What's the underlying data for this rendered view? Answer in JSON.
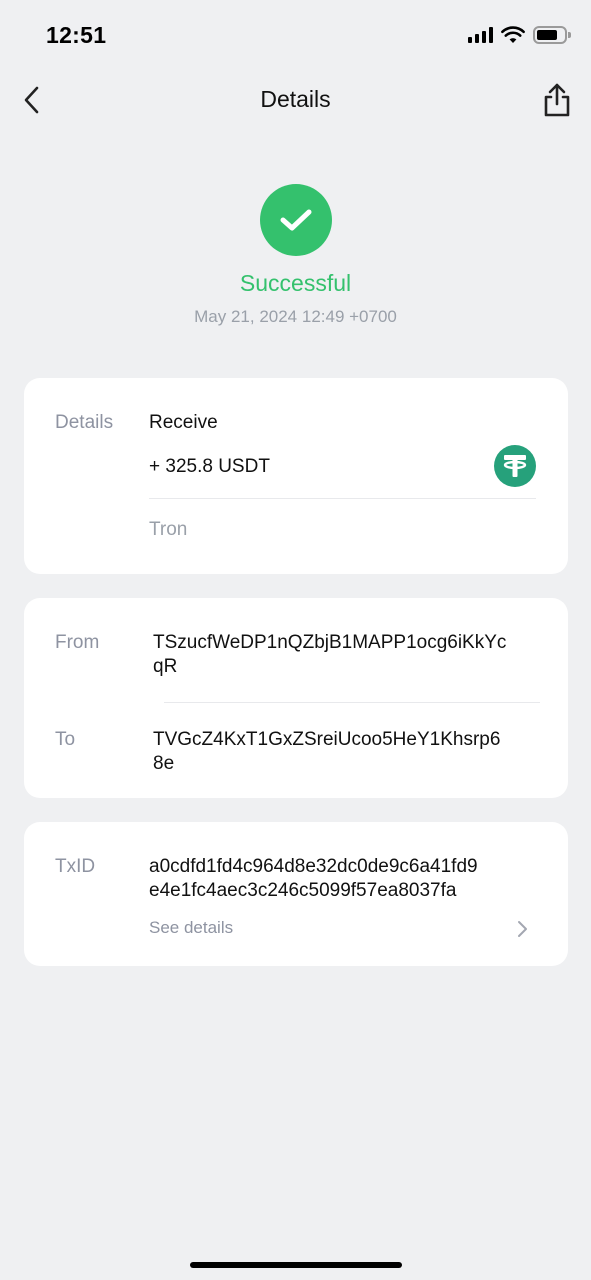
{
  "status_bar": {
    "time": "12:51"
  },
  "nav": {
    "title": "Details"
  },
  "hero": {
    "status": "Successful",
    "datetime": "May 21, 2024 12:49 +0700",
    "status_color": "#34c16d"
  },
  "details_card": {
    "label": "Details",
    "type": "Receive",
    "amount": "+ 325.8 USDT",
    "network": "Tron",
    "token_icon": "tether-icon",
    "token_color": "#26a17b"
  },
  "addresses_card": {
    "from_label": "From",
    "from_line1": "TSzucfWeDP1nQZbjB1MAPP1ocg6iKkYc",
    "from_line2": "qR",
    "to_label": "To",
    "to_line1": "TVGcZ4KxT1GxZSreiUcoo5HeY1Khsrp6",
    "to_line2": "8e"
  },
  "txid_card": {
    "label": "TxID",
    "txid_line1": "a0cdfd1fd4c964d8e32dc0de9c6a41fd9",
    "txid_line2": "e4e1fc4aec3c246c5099f57ea8037fa",
    "see_details": "See details"
  }
}
